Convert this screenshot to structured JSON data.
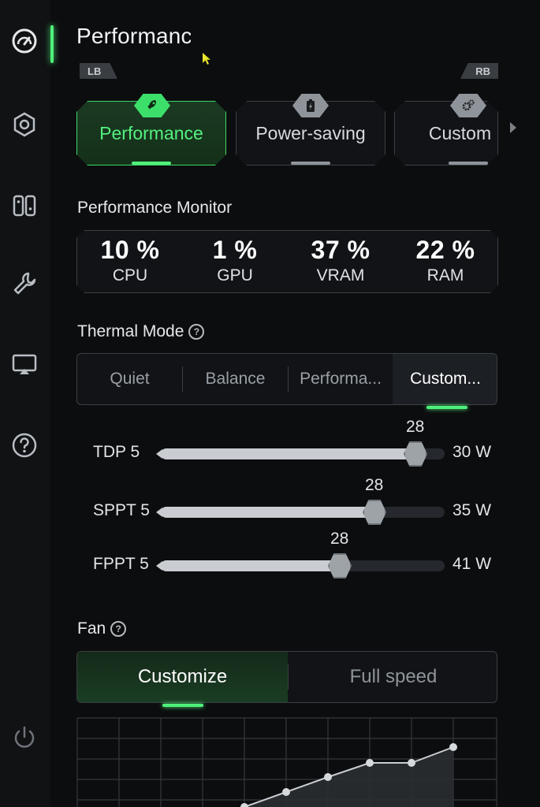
{
  "header": {
    "title": "Performance",
    "lb": "LB",
    "rb": "RB"
  },
  "sidebar": {
    "items": [
      {
        "name": "performance",
        "icon": "gauge-icon"
      },
      {
        "name": "settings",
        "icon": "hexagon-gear-icon"
      },
      {
        "name": "controller",
        "icon": "controller-icon"
      },
      {
        "name": "tools",
        "icon": "wrench-icon"
      },
      {
        "name": "display",
        "icon": "display-icon"
      },
      {
        "name": "help",
        "icon": "help-icon"
      },
      {
        "name": "power",
        "icon": "power-icon"
      }
    ]
  },
  "presets": [
    {
      "label": "Performance",
      "icon": "rocket-icon",
      "active": true
    },
    {
      "label": "Power-saving",
      "icon": "battery-icon",
      "active": false
    },
    {
      "label": "Custom",
      "icon": "gears-icon",
      "active": false
    }
  ],
  "monitor": {
    "title": "Performance Monitor",
    "metrics": [
      {
        "value": "10 %",
        "name": "CPU"
      },
      {
        "value": "1 %",
        "name": "GPU"
      },
      {
        "value": "37 %",
        "name": "VRAM"
      },
      {
        "value": "22 %",
        "name": "RAM"
      }
    ]
  },
  "thermal": {
    "title": "Thermal Mode",
    "modes": [
      "Quiet",
      "Balance",
      "Performa...",
      "Custom..."
    ],
    "selected": "Custom..."
  },
  "sliders": [
    {
      "label": "TDP",
      "min": "5",
      "value": 28,
      "max_label": "30 W",
      "min_val": 5,
      "max_val": 30
    },
    {
      "label": "SPPT",
      "min": "5",
      "value": 28,
      "max_label": "35 W",
      "min_val": 5,
      "max_val": 35
    },
    {
      "label": "FPPT",
      "min": "5",
      "value": 28,
      "max_label": "41 W",
      "min_val": 5,
      "max_val": 41
    }
  ],
  "fan": {
    "title": "Fan",
    "modes": [
      "Customize",
      "Full speed"
    ],
    "selected": "Customize"
  },
  "colors": {
    "accent": "#4ef07a",
    "background": "#0c0d0f"
  }
}
